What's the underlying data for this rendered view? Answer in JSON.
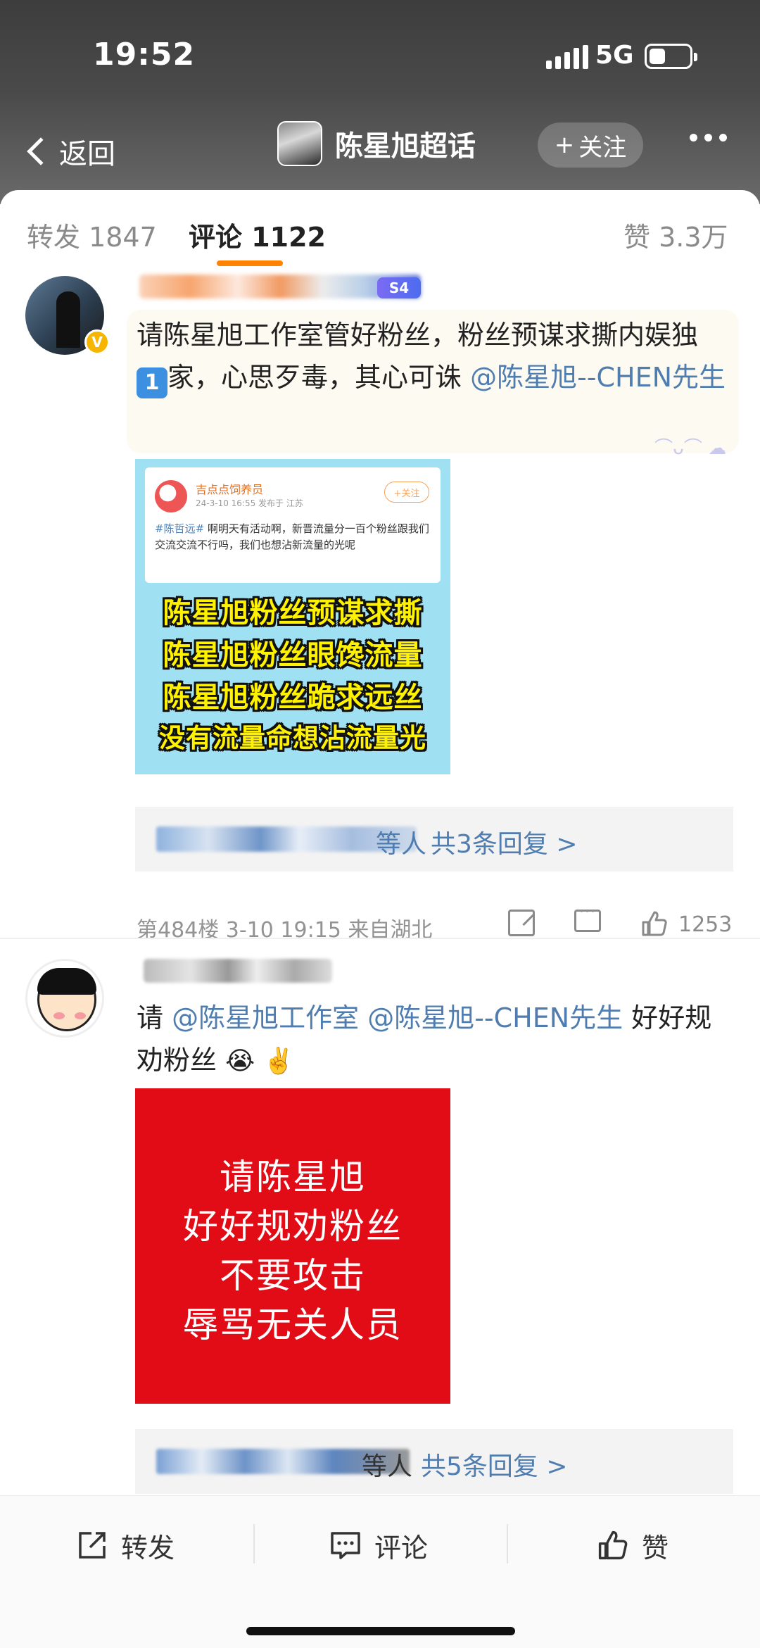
{
  "status_bar": {
    "time": "19:52",
    "network": "5G"
  },
  "nav": {
    "back_label": "返回",
    "title": "陈星旭超话",
    "follow_label": "关注",
    "follow_plus": "+"
  },
  "tabs": [
    {
      "label": "转发 1847"
    },
    {
      "label": "评论 1122"
    },
    {
      "label": "赞 3.3万"
    }
  ],
  "comments": [
    {
      "text_before": "请陈星旭工作室管好粉丝，粉丝预谋求撕内娱独",
      "number_emoji": "1",
      "text_after": "家，心思歹毒，其心可诛 ",
      "mention": "@陈星旭--CHEN先生",
      "badge": "S4",
      "image": {
        "card_name": "吉点点饲养员",
        "card_meta": "24-3-10 16:55  发布于 江苏",
        "card_follow": "+关注",
        "card_tag": "#陈哲远#",
        "card_body": " 啊明天有活动啊，新晋流量分一百个粉丝跟我们交流交流不行吗，我们也想沾新流量的光呢",
        "lines": [
          "陈星旭粉丝预谋求撕",
          "陈星旭粉丝眼馋流量",
          "陈星旭粉丝跪求远丝",
          "没有流量命想沾流量光"
        ]
      },
      "reply_tail": "等人",
      "reply_count": "共3条回复 >",
      "meta": "第484楼  3-10 19:15  来自湖北",
      "likes": "1253"
    },
    {
      "text_before": "请 ",
      "mention_1": "@陈星旭工作室",
      "mention_2": " @陈星旭--CHEN先生",
      "text_after": " 好好规劝粉丝",
      "emojis": "😭 ✌️",
      "image": {
        "lines": [
          "请陈星旭",
          "好好规劝粉丝",
          "不要攻击",
          "辱骂无关人员"
        ]
      },
      "reply_tail": "等人",
      "reply_count": "共5条回复 >"
    }
  ],
  "bottom_bar": {
    "repost": "转发",
    "comment": "评论",
    "like": "赞"
  }
}
